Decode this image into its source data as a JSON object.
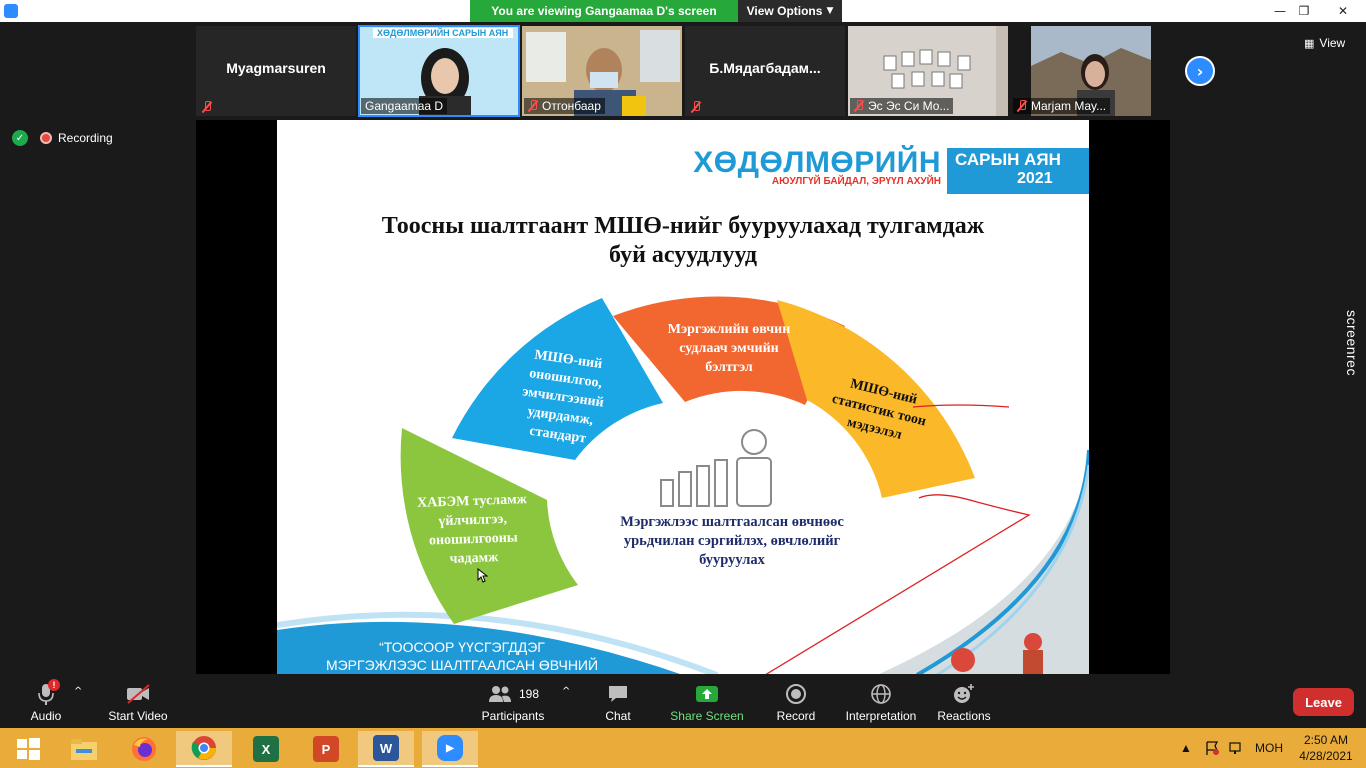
{
  "window": {
    "banner_text": "You are viewing Gangaamaa D's screen",
    "view_options_label": "View Options",
    "minimize_glyph": "—",
    "maximize_glyph": "❐",
    "close_glyph": "✕"
  },
  "participants_strip": {
    "items": [
      {
        "name": "Myagmarsuren",
        "display": "name-only"
      },
      {
        "name": "Gangaamaa D",
        "display": "video",
        "active": true
      },
      {
        "name": "Отгонбаар",
        "display": "video"
      },
      {
        "name": "Б.Мядагбадам...",
        "display": "name-only"
      },
      {
        "name": "Эс Эс Си Мо...",
        "display": "video"
      },
      {
        "name": "Marjam May...",
        "display": "video"
      }
    ],
    "next_icon": "chevron-right-icon",
    "view_label": "View"
  },
  "recording": {
    "label": "Recording",
    "shield_color": "#1ea94c",
    "dot_color": "#e04a3f"
  },
  "slide": {
    "logo_main": "ХӨДӨЛМӨРИЙН",
    "logo_sub": "АЮУЛГҮЙ БАЙДАЛ, ЭРҮҮЛ АХУЙН",
    "logo_box_line1": "САРЫН АЯН",
    "logo_box_line2": "2021",
    "title_line1": "Тоосны шалтгаант МШӨ-нийг бууруулахад тулгамдаж",
    "title_line2": "буй асуудлууд",
    "segments": [
      {
        "lines": [
          "ХАБЭМ тусламж",
          "үйлчилгээ,",
          "оношилгооны",
          "чадамж"
        ],
        "color": "#8cc63f"
      },
      {
        "lines": [
          "МШӨ-ний",
          "оношилгоо,",
          "эмчилгээний",
          "удирдамж,",
          "стандарт"
        ],
        "color": "#1ba7e6"
      },
      {
        "lines": [
          "Мэргэжлийн өвчин",
          "судлаач эмчийн",
          "бэлтгэл"
        ],
        "color": "#f26730"
      },
      {
        "lines": [
          "МШӨ-ний",
          "статистик тоон",
          "мэдээлэл"
        ],
        "color": "#fbb829"
      }
    ],
    "center_line1": "Мэргэжлээс шалтгаалсан өвчнөөс",
    "center_line2": "урьдчилан сэргийлэх, өвчлөлийг",
    "center_line3": "бууруулах",
    "bottom_line1": "“ТООСООР ҮҮСГЭГДДЭГ",
    "bottom_line2": "МЭРГЭЖЛЭЭС ШАЛТГААЛСАН ӨВЧНИЙ",
    "accent_blue": "#1f9ad6",
    "accent_red": "#e5332a"
  },
  "watermark": {
    "text": "screenrec"
  },
  "toolbar": {
    "audio_label": "Audio",
    "audio_badge": "!",
    "video_label": "Start Video",
    "participants_count": "198",
    "participants_label": "Participants",
    "chat_label": "Chat",
    "share_label": "Share Screen",
    "record_label": "Record",
    "interpretation_label": "Interpretation",
    "reactions_label": "Reactions",
    "leave_label": "Leave",
    "share_color": "#27a83a",
    "leave_color": "#d12e2e"
  },
  "taskbar": {
    "apps": [
      "windows-start",
      "file-explorer",
      "firefox",
      "chrome",
      "excel",
      "powerpoint",
      "word",
      "zoom"
    ],
    "active_app": "chrome",
    "language": "МОН",
    "time": "2:50 AM",
    "date": "4/28/2021",
    "tray_caret": "▲",
    "color": "#e9ab3a"
  }
}
